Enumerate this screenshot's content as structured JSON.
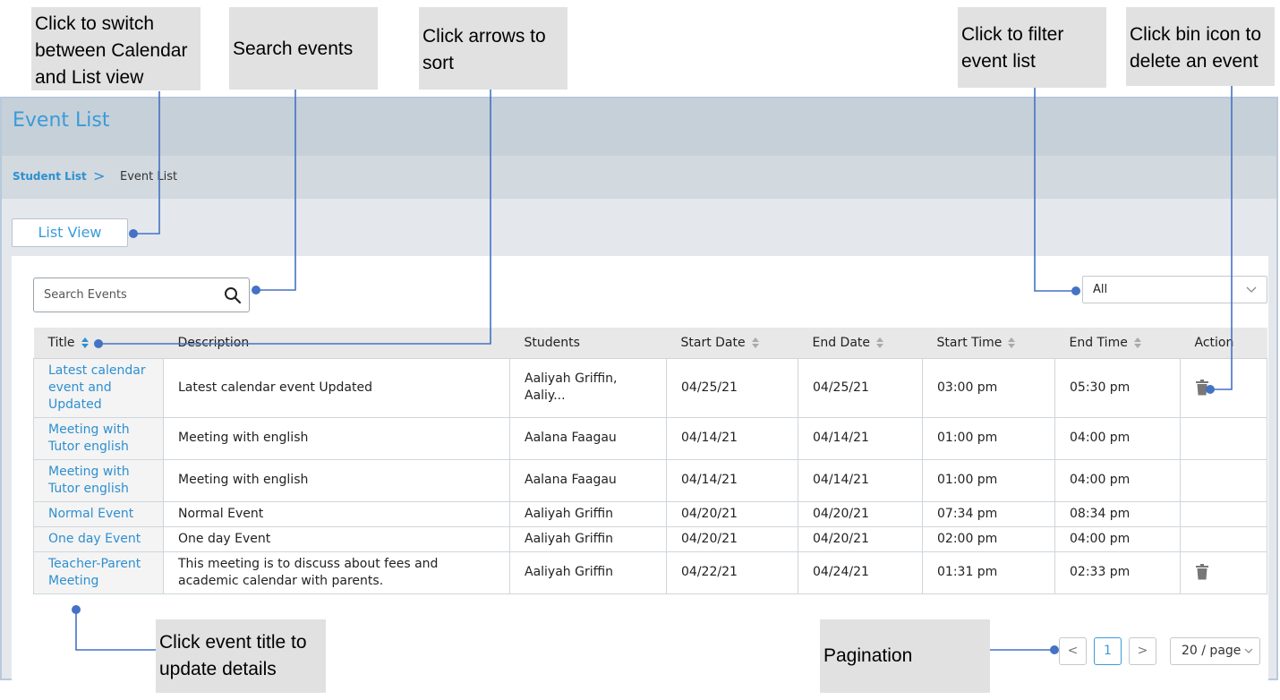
{
  "annotations": {
    "toggle_view": "Click to switch\nbetween Calendar\nand List view",
    "search": "Search events",
    "sort": "Click arrows to\nsort",
    "filter": "Click to filter\nevent list",
    "delete": "Click bin icon to\ndelete an event",
    "title_click": "Click event title to\nupdate details",
    "pagination": "Pagination"
  },
  "header": {
    "title": "Event List"
  },
  "breadcrumb": {
    "parent": "Student List",
    "separator": ">",
    "current": "Event List"
  },
  "view_toggle": {
    "label": "List View"
  },
  "search": {
    "placeholder": "Search Events",
    "value": ""
  },
  "filter": {
    "selected": "All"
  },
  "table": {
    "columns": [
      "Title",
      "Description",
      "Students",
      "Start Date",
      "End Date",
      "Start Time",
      "End Time",
      "Action"
    ],
    "rows": [
      {
        "title": "Latest calendar event and Updated",
        "description": "Latest calendar event Updated",
        "students": "Aaliyah Griffin, Aaliy...",
        "start_date": "04/25/21",
        "end_date": "04/25/21",
        "start_time": "03:00 pm",
        "end_time": "05:30 pm",
        "deletable": true
      },
      {
        "title": "Meeting with Tutor english",
        "description": "Meeting with english",
        "students": "Aalana Faagau",
        "start_date": "04/14/21",
        "end_date": "04/14/21",
        "start_time": "01:00 pm",
        "end_time": "04:00 pm",
        "deletable": false
      },
      {
        "title": "Meeting with Tutor english",
        "description": "Meeting with english",
        "students": "Aalana Faagau",
        "start_date": "04/14/21",
        "end_date": "04/14/21",
        "start_time": "01:00 pm",
        "end_time": "04:00 pm",
        "deletable": false
      },
      {
        "title": "Normal Event",
        "description": "Normal Event",
        "students": "Aaliyah Griffin",
        "start_date": "04/20/21",
        "end_date": "04/20/21",
        "start_time": "07:34 pm",
        "end_time": "08:34 pm",
        "deletable": false
      },
      {
        "title": "One day Event",
        "description": "One day Event",
        "students": "Aaliyah Griffin",
        "start_date": "04/20/21",
        "end_date": "04/20/21",
        "start_time": "02:00 pm",
        "end_time": "04:00 pm",
        "deletable": false
      },
      {
        "title": "Teacher-Parent Meeting",
        "description": "This meeting is to discuss about fees and academic calendar with parents.",
        "students": "Aaliyah Griffin",
        "start_date": "04/22/21",
        "end_date": "04/24/21",
        "start_time": "01:31 pm",
        "end_time": "02:33 pm",
        "deletable": true
      }
    ]
  },
  "pagination": {
    "prev": "<",
    "current_page": "1",
    "next": ">",
    "page_size": "20 / page"
  },
  "colors": {
    "accent": "#3a9bd9",
    "callout_line": "#4472c4",
    "header_bg": "#c6d0d9"
  },
  "icons": {
    "search": "search-icon",
    "sort": "sort-icon",
    "delete": "trash-icon",
    "dropdown": "chevron-down-icon"
  }
}
